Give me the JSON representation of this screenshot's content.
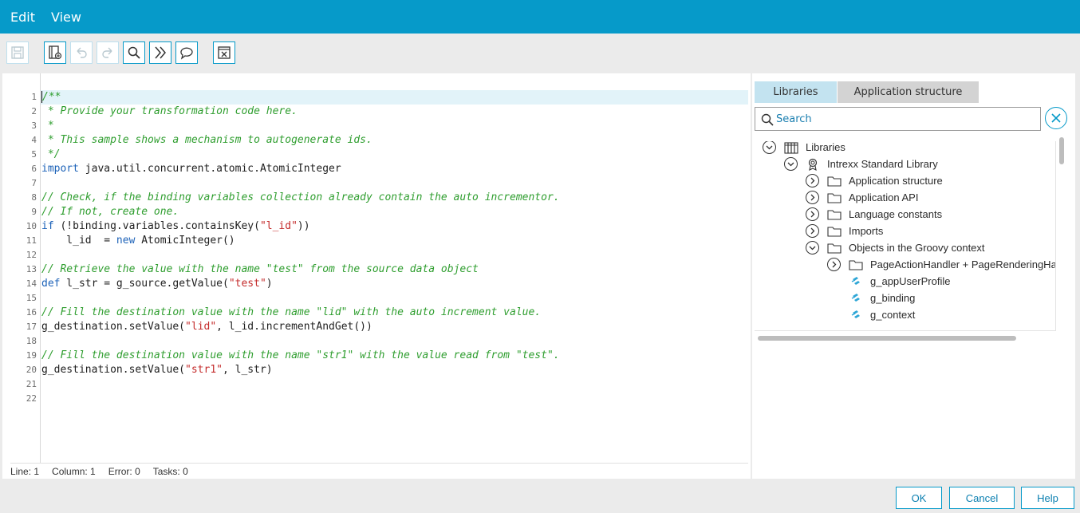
{
  "menu": {
    "edit": "Edit",
    "view": "View"
  },
  "toolbar": {
    "buttons": [
      {
        "name": "save",
        "icon": "save-icon",
        "enabled": false
      },
      {
        "name": "template",
        "icon": "template-icon",
        "enabled": true
      },
      {
        "name": "undo",
        "icon": "undo-icon",
        "enabled": false
      },
      {
        "name": "redo",
        "icon": "redo-icon",
        "enabled": false
      },
      {
        "name": "find",
        "icon": "search-icon",
        "enabled": true
      },
      {
        "name": "goto",
        "icon": "double-chevron-right-icon",
        "enabled": true
      },
      {
        "name": "comment",
        "icon": "speech-bubble-icon",
        "enabled": true
      },
      {
        "name": "close-editor",
        "icon": "close-box-icon",
        "enabled": true
      }
    ]
  },
  "editor": {
    "active_line": 1,
    "lines": [
      [
        {
          "t": "/**",
          "c": "com"
        }
      ],
      [
        {
          "t": " * Provide your transformation code here.",
          "c": "com"
        }
      ],
      [
        {
          "t": " *",
          "c": "com"
        }
      ],
      [
        {
          "t": " * This sample shows a mechanism to autogenerate ids.",
          "c": "com"
        }
      ],
      [
        {
          "t": " */",
          "c": "com"
        }
      ],
      [
        {
          "t": "import",
          "c": "kw"
        },
        {
          "t": " java.util.concurrent.atomic.AtomicInteger",
          "c": "pl"
        }
      ],
      [],
      [
        {
          "t": "// Check, if the binding variables collection already contain the auto incrementor.",
          "c": "com"
        }
      ],
      [
        {
          "t": "// If not, create one.",
          "c": "com"
        }
      ],
      [
        {
          "t": "if",
          "c": "kw"
        },
        {
          "t": " (!binding.variables.containsKey(",
          "c": "pl"
        },
        {
          "t": "\"l_id\"",
          "c": "str"
        },
        {
          "t": "))",
          "c": "pl"
        }
      ],
      [
        {
          "t": "    l_id  = ",
          "c": "pl"
        },
        {
          "t": "new",
          "c": "kw"
        },
        {
          "t": " AtomicInteger()",
          "c": "pl"
        }
      ],
      [],
      [
        {
          "t": "// Retrieve the value with the name \"test\" from the source data object",
          "c": "com"
        }
      ],
      [
        {
          "t": "def",
          "c": "kw"
        },
        {
          "t": " l_str = g_source.getValue(",
          "c": "pl"
        },
        {
          "t": "\"test\"",
          "c": "str"
        },
        {
          "t": ")",
          "c": "pl"
        }
      ],
      [],
      [
        {
          "t": "// Fill the destination value with the name \"lid\" with the auto increment value.",
          "c": "com"
        }
      ],
      [
        {
          "t": "g_destination.setValue(",
          "c": "pl"
        },
        {
          "t": "\"lid\"",
          "c": "str"
        },
        {
          "t": ", l_id.incrementAndGet())",
          "c": "pl"
        }
      ],
      [],
      [
        {
          "t": "// Fill the destination value with the name \"str1\" with the value read from \"test\".",
          "c": "com"
        }
      ],
      [
        {
          "t": "g_destination.setValue(",
          "c": "pl"
        },
        {
          "t": "\"str1\"",
          "c": "str"
        },
        {
          "t": ", l_str)",
          "c": "pl"
        }
      ],
      [],
      []
    ]
  },
  "status": {
    "line": "Line: 1",
    "column": "Column: 1",
    "error": "Error: 0",
    "tasks": "Tasks: 0"
  },
  "sidebar": {
    "tabs": [
      {
        "label": "Libraries",
        "active": true
      },
      {
        "label": "Application structure",
        "active": false
      }
    ],
    "search": {
      "placeholder": "Search",
      "value": ""
    },
    "tree": [
      {
        "label": "Libraries",
        "level": 0,
        "toggle": "expanded",
        "icon": "books-icon"
      },
      {
        "label": "Intrexx Standard Library",
        "level": 1,
        "toggle": "expanded",
        "icon": "award-icon"
      },
      {
        "label": "Application structure",
        "level": 2,
        "toggle": "collapsed",
        "icon": "folder-icon"
      },
      {
        "label": "Application API",
        "level": 2,
        "toggle": "collapsed",
        "icon": "folder-icon"
      },
      {
        "label": "Language constants",
        "level": 2,
        "toggle": "collapsed",
        "icon": "folder-icon"
      },
      {
        "label": "Imports",
        "level": 2,
        "toggle": "collapsed",
        "icon": "folder-icon"
      },
      {
        "label": "Objects in the Groovy context",
        "level": 2,
        "toggle": "expanded",
        "icon": "folder-icon"
      },
      {
        "label": "PageActionHandler + PageRenderingHa",
        "level": 3,
        "toggle": "collapsed",
        "icon": "folder-icon"
      },
      {
        "label": "g_appUserProfile",
        "level": 4,
        "toggle": "none",
        "icon": "variable-icon"
      },
      {
        "label": "g_binding",
        "level": 4,
        "toggle": "none",
        "icon": "variable-icon"
      },
      {
        "label": "g_context",
        "level": 4,
        "toggle": "none",
        "icon": "variable-icon"
      }
    ]
  },
  "footer": {
    "ok": "OK",
    "cancel": "Cancel",
    "help": "Help"
  },
  "colors": {
    "accent": "#069ac9",
    "comment": "#2f9e2f",
    "keyword": "#1c62b8",
    "string": "#c42b2b",
    "active_line": "#e2f3f9"
  }
}
